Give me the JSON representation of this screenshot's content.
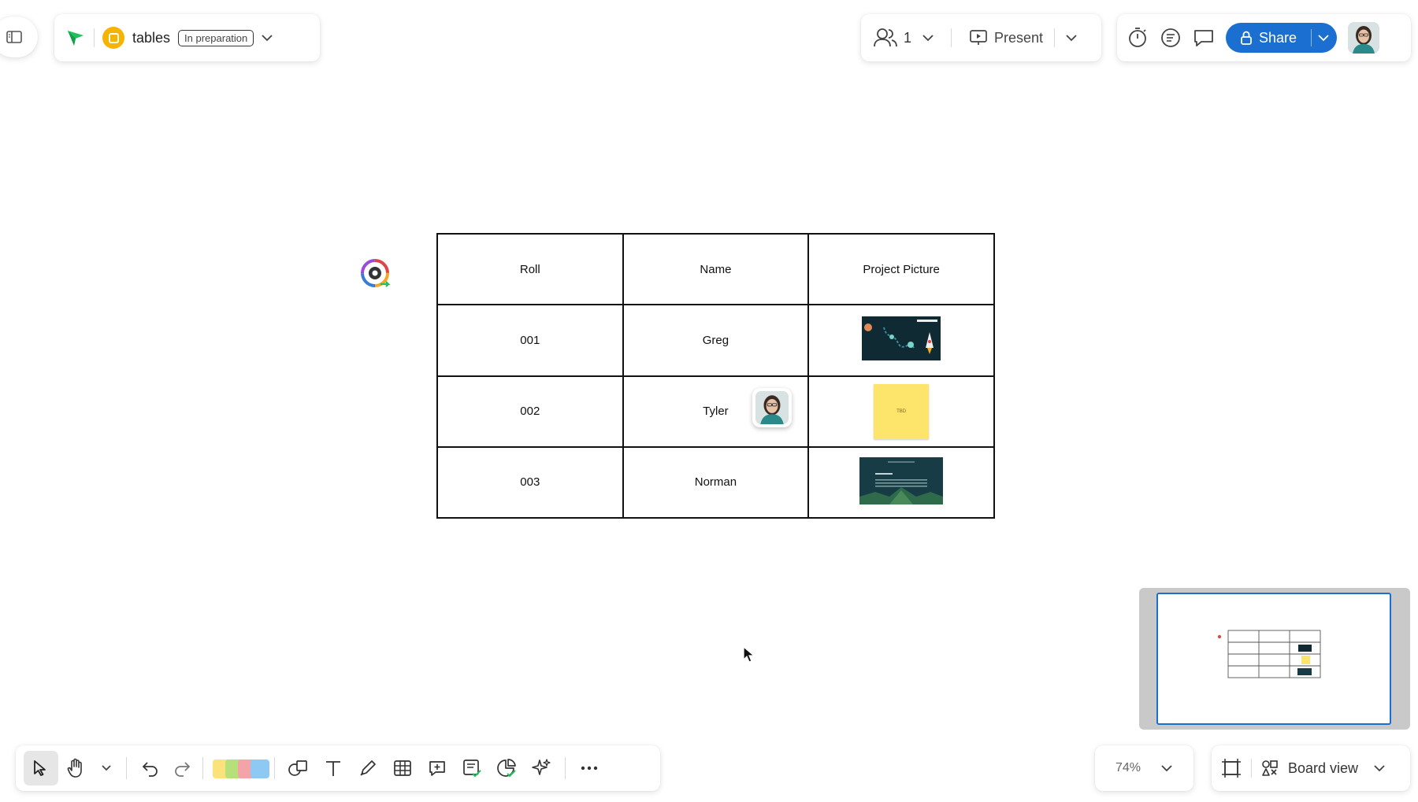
{
  "header": {
    "board_title": "tables",
    "status_badge": "In preparation",
    "collaborator_count": "1",
    "present_label": "Present",
    "share_label": "Share"
  },
  "table": {
    "headers": [
      "Roll",
      "Name",
      "Project Picture"
    ],
    "rows": [
      {
        "roll": "001",
        "name": "Greg",
        "picture": "space-game-screenshot"
      },
      {
        "roll": "002",
        "name": "Tyler",
        "picture": "yellow-sticky-note",
        "sticky_text": "TBD"
      },
      {
        "roll": "003",
        "name": "Norman",
        "picture": "dark-slide-screenshot"
      }
    ]
  },
  "footer": {
    "zoom_level": "74%",
    "view_label": "Board view"
  },
  "colors": {
    "accent_blue": "#1b6fd1",
    "brand_green": "#1fc15b",
    "board_logo": "#f6b400",
    "sticky_yellow": "#fde46b"
  },
  "icons": [
    "sidebar-toggle-icon",
    "brand-flag-icon",
    "people-icon",
    "present-icon",
    "timer-icon",
    "list-icon",
    "comment-icon",
    "lock-icon",
    "select-arrow-icon",
    "hand-icon",
    "undo-icon",
    "redo-icon",
    "shapes-icon",
    "text-icon",
    "pen-icon",
    "table-icon",
    "comment-plus-icon",
    "card-icon",
    "pie-check-icon",
    "ai-sparkle-icon",
    "more-icon",
    "frame-icon",
    "board-view-icon"
  ]
}
